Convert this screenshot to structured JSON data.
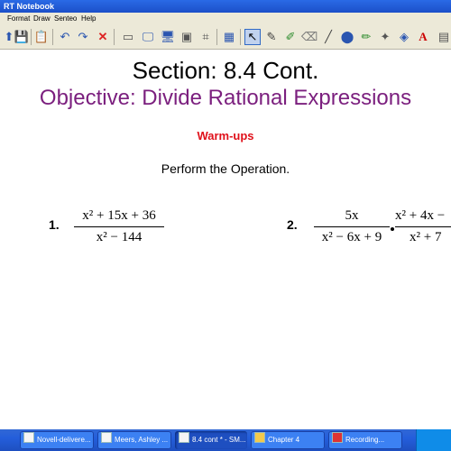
{
  "window": {
    "title": "RT Notebook"
  },
  "menu": {
    "items": [
      "Format",
      "Draw",
      "Senteo",
      "Help"
    ]
  },
  "toolbar": {
    "icons": [
      "undo-icon",
      "redo-icon",
      "delete-icon"
    ]
  },
  "slide": {
    "title": "Section: 8.4 Cont.",
    "objective": "Objective: Divide Rational Expressions",
    "warmups": "Warm-ups",
    "instruction": "Perform the Operation.",
    "p1": {
      "label": "1.",
      "numerator": "x² + 15x + 36",
      "denominator": "x² − 144"
    },
    "p2": {
      "label": "2.",
      "left_num": "5x",
      "left_den": "x² − 6x + 9",
      "right_num": "x² + 4x −",
      "right_den": "x² + 7"
    }
  },
  "taskbar": {
    "items": [
      "Novell-delivere...",
      "Meers, Ashley ...",
      "8.4 cont * - SM...",
      "Chapter 4",
      "Recording..."
    ]
  }
}
